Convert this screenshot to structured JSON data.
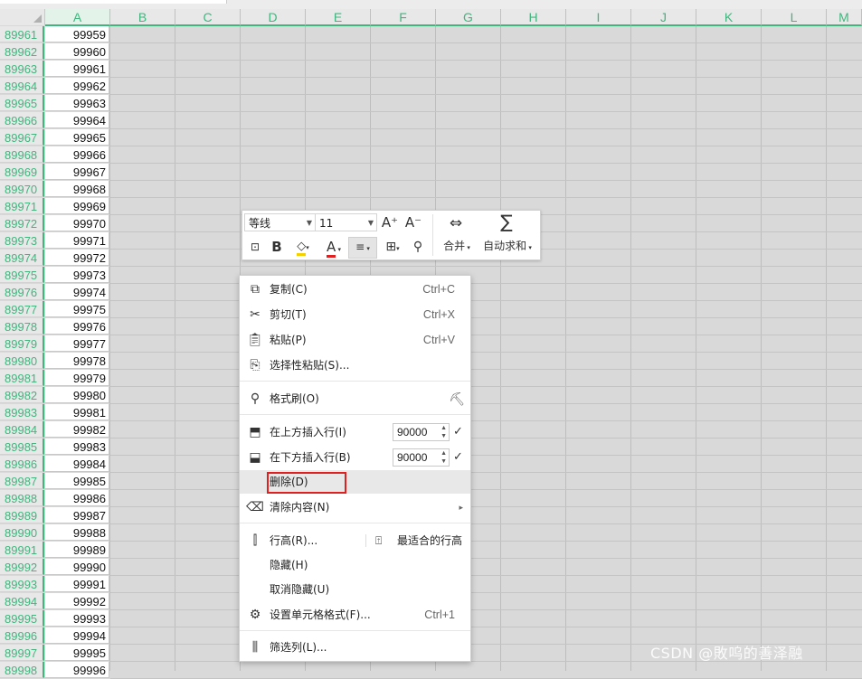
{
  "columns": [
    "A",
    "B",
    "C",
    "D",
    "E",
    "F",
    "G",
    "H",
    "I",
    "J",
    "K",
    "L",
    "M"
  ],
  "rows": [
    {
      "row": "89961",
      "value": "99959"
    },
    {
      "row": "89962",
      "value": "99960"
    },
    {
      "row": "89963",
      "value": "99961"
    },
    {
      "row": "89964",
      "value": "99962"
    },
    {
      "row": "89965",
      "value": "99963"
    },
    {
      "row": "89966",
      "value": "99964"
    },
    {
      "row": "89967",
      "value": "99965"
    },
    {
      "row": "89968",
      "value": "99966"
    },
    {
      "row": "89969",
      "value": "99967"
    },
    {
      "row": "89970",
      "value": "99968"
    },
    {
      "row": "89971",
      "value": "99969"
    },
    {
      "row": "89972",
      "value": "99970"
    },
    {
      "row": "89973",
      "value": "99971"
    },
    {
      "row": "89974",
      "value": "99972"
    },
    {
      "row": "89975",
      "value": "99973"
    },
    {
      "row": "89976",
      "value": "99974"
    },
    {
      "row": "89977",
      "value": "99975"
    },
    {
      "row": "89978",
      "value": "99976"
    },
    {
      "row": "89979",
      "value": "99977"
    },
    {
      "row": "89980",
      "value": "99978"
    },
    {
      "row": "89981",
      "value": "99979"
    },
    {
      "row": "89982",
      "value": "99980"
    },
    {
      "row": "89983",
      "value": "99981"
    },
    {
      "row": "89984",
      "value": "99982"
    },
    {
      "row": "89985",
      "value": "99983"
    },
    {
      "row": "89986",
      "value": "99984"
    },
    {
      "row": "89987",
      "value": "99985"
    },
    {
      "row": "89988",
      "value": "99986"
    },
    {
      "row": "89989",
      "value": "99987"
    },
    {
      "row": "89990",
      "value": "99988"
    },
    {
      "row": "89991",
      "value": "99989"
    },
    {
      "row": "89992",
      "value": "99990"
    },
    {
      "row": "89993",
      "value": "99991"
    },
    {
      "row": "89994",
      "value": "99992"
    },
    {
      "row": "89995",
      "value": "99993"
    },
    {
      "row": "89996",
      "value": "99994"
    },
    {
      "row": "89997",
      "value": "99995"
    },
    {
      "row": "89998",
      "value": "99996"
    }
  ],
  "mini_toolbar": {
    "font_name": "等线",
    "font_size": "11",
    "increase_font": "A⁺",
    "decrease_font": "A⁻",
    "merge_label": "合并",
    "autosum_label": "自动求和",
    "bold": "B",
    "font_color_letter": "A"
  },
  "context_menu": {
    "copy": {
      "label": "复制(C)",
      "shortcut": "Ctrl+C"
    },
    "cut": {
      "label": "剪切(T)",
      "shortcut": "Ctrl+X"
    },
    "paste": {
      "label": "粘贴(P)",
      "shortcut": "Ctrl+V"
    },
    "paste_special": {
      "label": "选择性粘贴(S)..."
    },
    "format_painter": {
      "label": "格式刷(O)"
    },
    "insert_above": {
      "label": "在上方插入行(I)",
      "value": "90000"
    },
    "insert_below": {
      "label": "在下方插入行(B)",
      "value": "90000"
    },
    "delete": {
      "label": "删除(D)"
    },
    "clear_contents": {
      "label": "清除内容(N)"
    },
    "row_height": {
      "label": "行高(R)...",
      "extra": "最适合的行高"
    },
    "hide": {
      "label": "隐藏(H)"
    },
    "unhide": {
      "label": "取消隐藏(U)"
    },
    "format_cells": {
      "label": "设置单元格格式(F)...",
      "shortcut": "Ctrl+1"
    },
    "filter_column": {
      "label": "筛选列(L)..."
    }
  },
  "watermark": "CSDN @敗呜的善泽融",
  "colors": {
    "accent": "#3fb67e",
    "highlight": "#e02020",
    "grid_bg": "#d9d9d9"
  }
}
